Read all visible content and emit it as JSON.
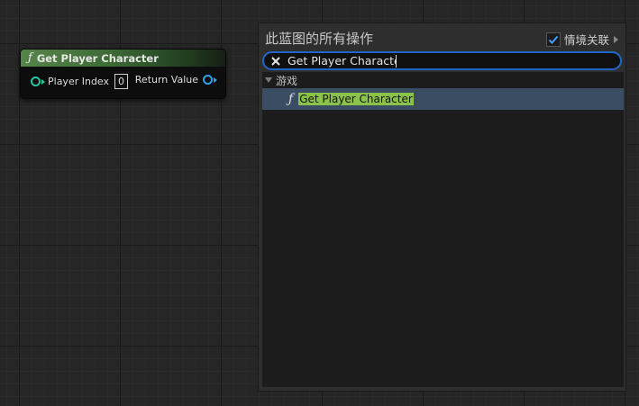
{
  "node": {
    "func_glyph": "ƒ",
    "title": "Get Player Character",
    "input_label": "Player Index",
    "input_value": "0",
    "output_label": "Return Value"
  },
  "menu": {
    "title": "此蓝图的所有操作",
    "context_label": "情境关联",
    "context_checked": true,
    "search_value": "Get Player Character",
    "category": "游戏",
    "items": [
      {
        "glyph": "ƒ",
        "label": "Get Player Character"
      }
    ]
  },
  "colors": {
    "search_border": "#1f66c9",
    "selected_row": "#3b4d62",
    "highlight": "#8bc34a",
    "pin_int": "#26c6a0",
    "pin_object": "#2aa5e8"
  }
}
